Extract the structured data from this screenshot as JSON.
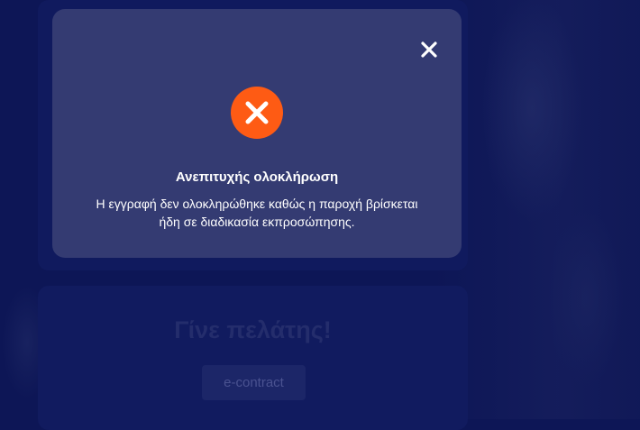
{
  "modal": {
    "title": "Ανεπιτυχής ολοκλήρωση",
    "message": "Η εγγραφή δεν ολοκληρώθηκε καθώς η παροχή βρίσκεται ήδη σε διαδικασία εκπροσώπησης.",
    "icon": "error-x-icon",
    "icon_color": "#fe5b14",
    "close_icon": "close-icon"
  },
  "customer_card": {
    "heading": "Γίνε πελάτης!",
    "button_label": "e-contract"
  },
  "colors": {
    "page_background": "#0d1656",
    "modal_background": "#343b72",
    "accent": "#fe5b14"
  }
}
